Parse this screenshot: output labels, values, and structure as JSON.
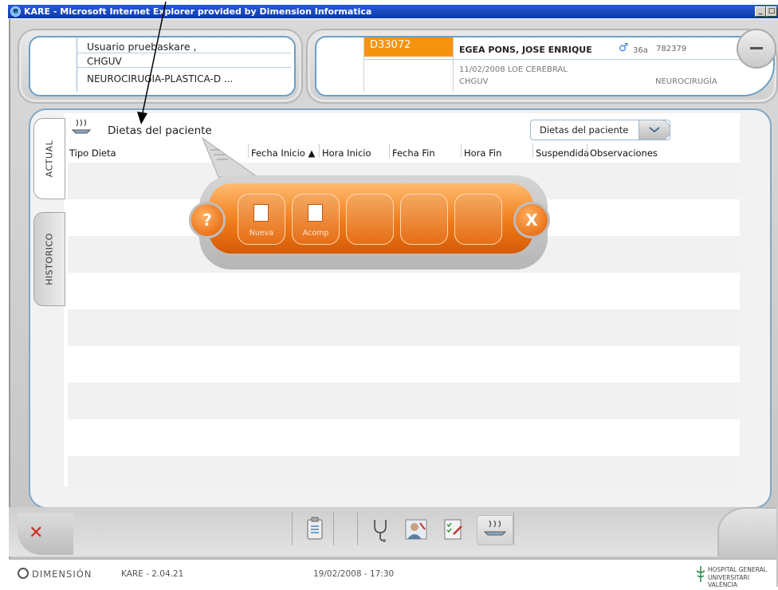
{
  "window": {
    "title": "KARE - Microsoft Internet Explorer provided by Dimension Informatica"
  },
  "user": {
    "name": "Usuario pruebaskare ,",
    "center": "CHGUV",
    "service": "NEUROCIRUGIA-PLASTICA-D ..."
  },
  "patient": {
    "episode": "D33072",
    "name": "EGEA PONS, JOSE ENRIQUE",
    "age": "36a",
    "id": "782379",
    "date_diagnosis": "11/02/2008  LOE CEREBRAL",
    "center": "CHGUV",
    "service": "NEUROCIRUGÍA"
  },
  "section": {
    "title": "Dietas del paciente"
  },
  "dropdown": {
    "selected": "Dietas del paciente"
  },
  "tabs": {
    "actual": "ACTUAL",
    "historico": "HISTORICO"
  },
  "table": {
    "columns": [
      "Tipo Dieta",
      "Fecha Inicio ▲",
      "Hora Inicio",
      "Fecha Fin",
      "Hora Fin",
      "Suspendida",
      "Observaciones"
    ]
  },
  "popup": {
    "help": "?",
    "close": "X",
    "tools": [
      "Nueva",
      "Acomp"
    ]
  },
  "status": {
    "brand": "DIMENSIÓN",
    "version": "KARE - 2.04.21",
    "datetime": "19/02/2008  - 17:30",
    "hospital_line1": "HOSPITAL GENERAL",
    "hospital_line2": "UNIVERSITARI VALÈNCIA"
  },
  "colors": {
    "accent_orange": "#f07c1a",
    "frame_blue": "#7ea8c9",
    "episode_bg": "#f5930f"
  }
}
